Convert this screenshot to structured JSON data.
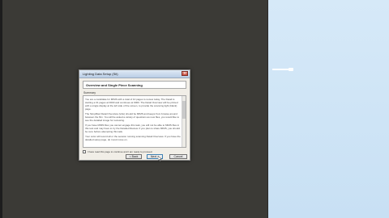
{
  "dialog": {
    "title": "Lighting Data Setup (Sit)",
    "heading": "Overview and Single Piece Scanning",
    "section_label": "Summary",
    "paragraphs": [
      "You are a candidate for MIMS with a total of 10 pages to review today. The Detail is starting a 01 pages at 0000 and continues at 0000. The Detail Overview will be printed with a single display at the left side of the screen, to provide the scanning light (blank) page.",
      "The Simplified Detail Overview (who) should be MIMS and keeps from browse around between the film. You will be asked a variety of questions as new files, you would like to see the detailed image for reviewing.",
      "If you have MIMS files you cannot engage this task, you will not be able to MIMS files in this test and may have to try the Detailed Review. If you plan to share MIMS, you should be sure before attempting this task.",
      "Your color will record all or the session running scanning Detail Overview. If you have the detailed setup page, do it and move on."
    ],
    "checkbox_label": "I have read this page to continue and I am ready to proceed.",
    "close_glyph": "x",
    "buttons": {
      "back": "< Back",
      "next": "Next >",
      "cancel": "Cancel"
    }
  },
  "colors": {
    "canvas": "#3b3a36",
    "right_panel": "#cfe4f6",
    "dialog_bg": "#f1eee7"
  },
  "icons": {
    "cursor": "arrow-cursor-icon",
    "handle": "drag-handle-icon"
  }
}
